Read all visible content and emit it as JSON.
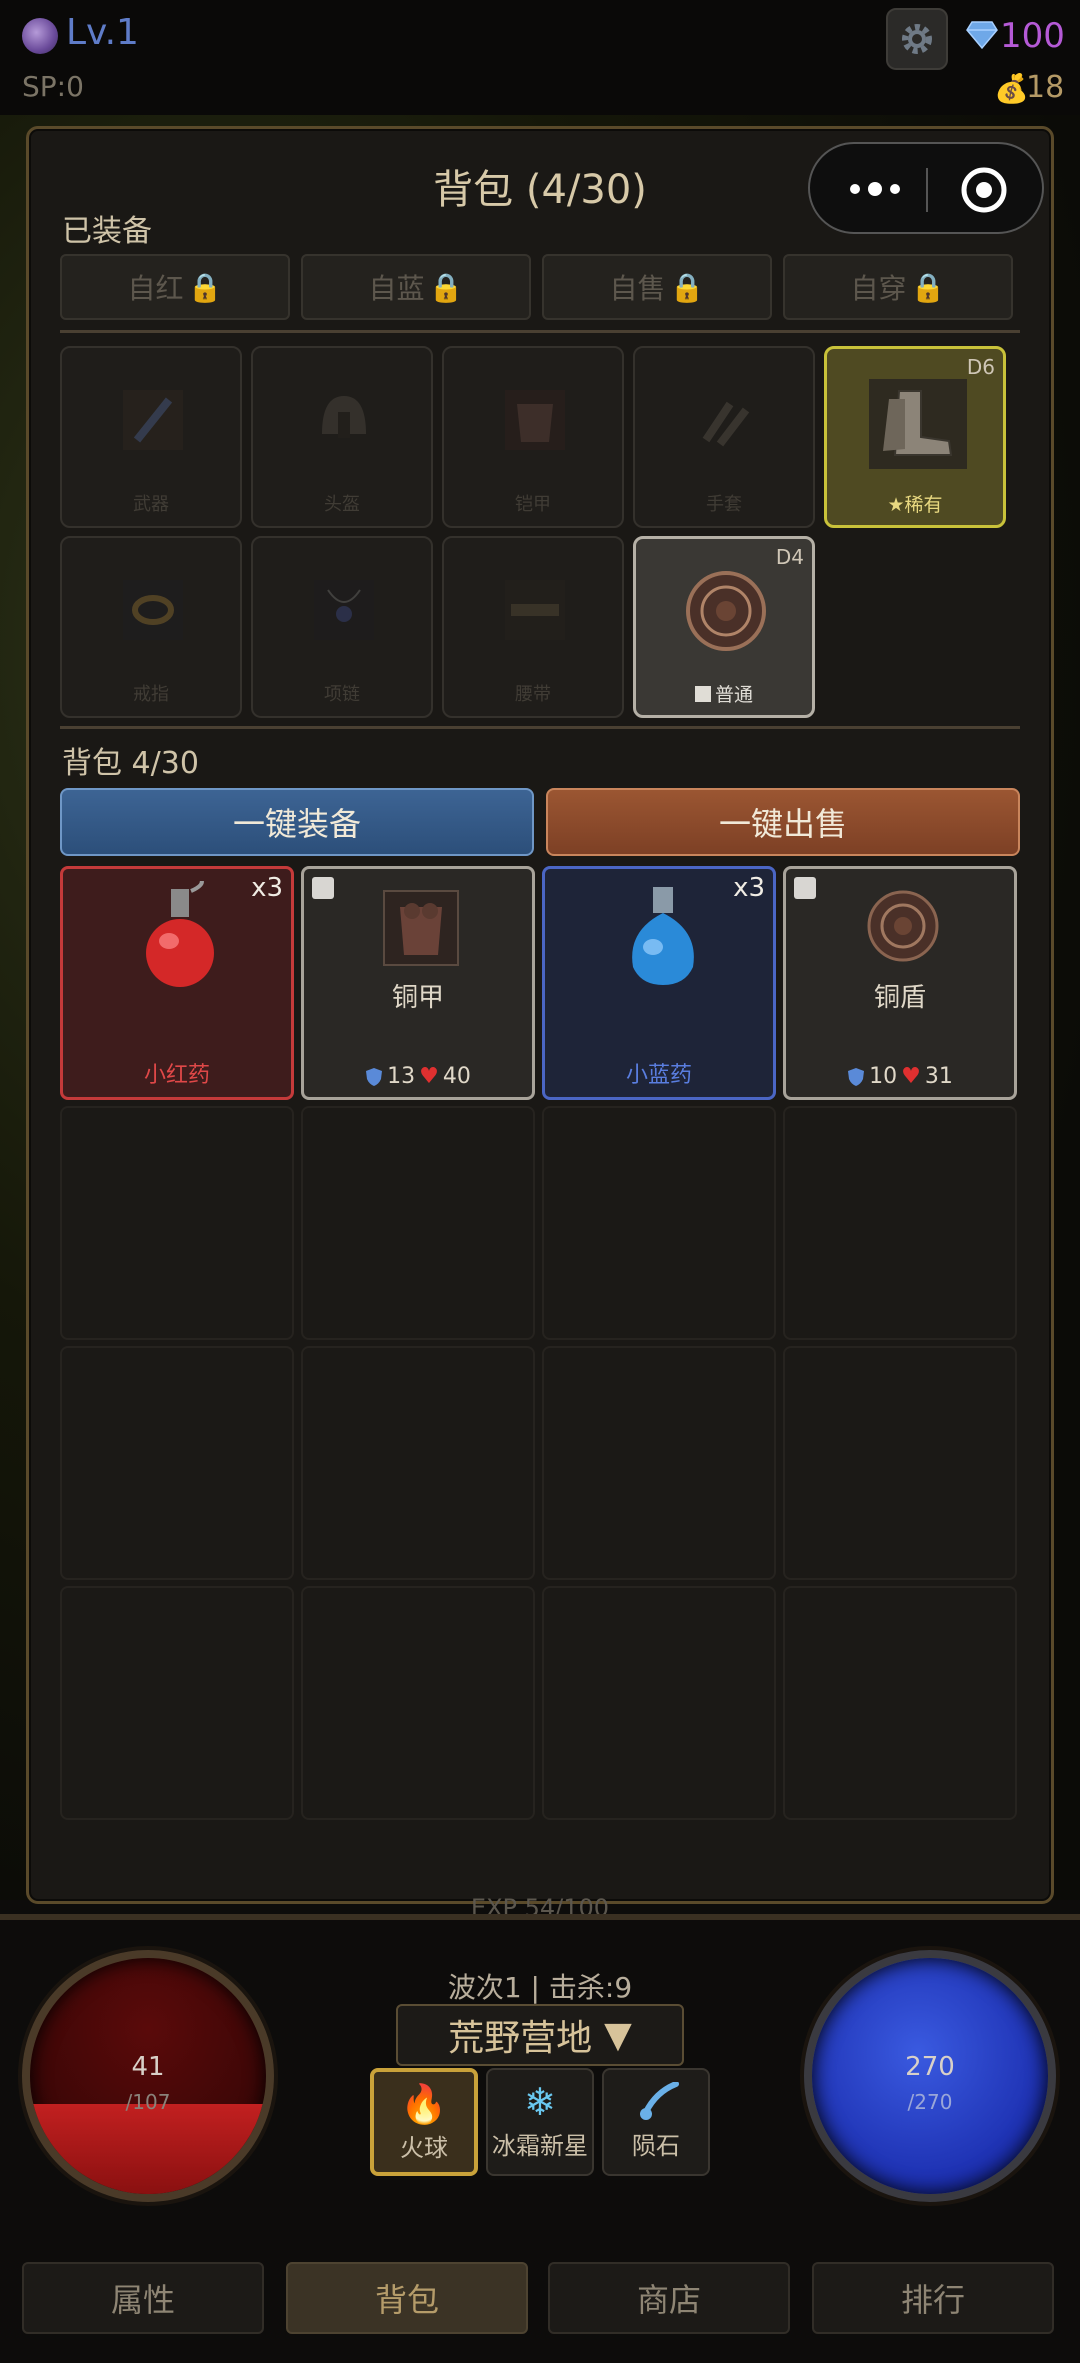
{
  "header": {
    "level": "Lv.1",
    "sp": "SP:0",
    "gems": "100",
    "money": "18"
  },
  "panel": {
    "title": "背包 (4/30)",
    "equipped_label": "已装备",
    "auto_buttons": [
      "自红",
      "自蓝",
      "自售",
      "自穿"
    ],
    "slots": {
      "weapon": "武器",
      "helmet": "头盔",
      "armor": "铠甲",
      "gloves": "手套",
      "boots_quality": "★稀有",
      "boots_tag": "D6",
      "ring": "戒指",
      "necklace": "项链",
      "belt": "腰带",
      "shield_quality": "普通",
      "shield_tag": "D4"
    },
    "bag_label": "背包 4/30",
    "equip_all": "一键装备",
    "sell_all": "一键出售",
    "items": [
      {
        "name": "小红药",
        "count": "x3"
      },
      {
        "name": "铜甲",
        "def": "13",
        "hp": "40"
      },
      {
        "name": "小蓝药",
        "count": "x3"
      },
      {
        "name": "铜盾",
        "def": "10",
        "hp": "31"
      }
    ]
  },
  "hud": {
    "exp": "EXP 54/100",
    "hp_cur": "41",
    "hp_max": "/107",
    "hp_fraction": 0.38,
    "mp_cur": "270",
    "mp_max": "/270",
    "wave": "波次1 | 击杀:9",
    "map": "荒野营地",
    "skills": [
      "火球",
      "冰霜新星",
      "陨石"
    ]
  },
  "nav": [
    "属性",
    "背包",
    "商店",
    "排行"
  ],
  "colors": {
    "rare": "#c9c23a",
    "potion_red": "#e04848",
    "potion_blue": "#5a7ee0",
    "gold": "#c9a23a"
  }
}
